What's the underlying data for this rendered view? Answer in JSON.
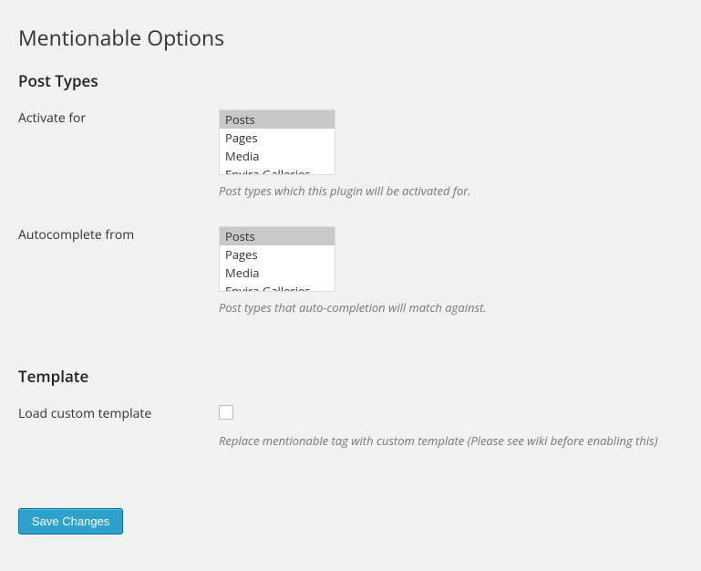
{
  "page_title": "Mentionable Options",
  "sections": {
    "post_types_heading": "Post Types",
    "template_heading": "Template"
  },
  "activate_for": {
    "label": "Activate for",
    "options": [
      "Posts",
      "Pages",
      "Media",
      "Envira Galleries"
    ],
    "selected": "Posts",
    "description": "Post types which this plugin will be activated for."
  },
  "autocomplete_from": {
    "label": "Autocomplete from",
    "options": [
      "Posts",
      "Pages",
      "Media",
      "Envira Galleries"
    ],
    "selected": "Posts",
    "description": "Post types that auto-completion will match against."
  },
  "load_custom_template": {
    "label": "Load custom template",
    "checked": false,
    "description": "Replace mentionable tag with custom template (Please see wiki before enabling this)"
  },
  "save_button": "Save Changes"
}
